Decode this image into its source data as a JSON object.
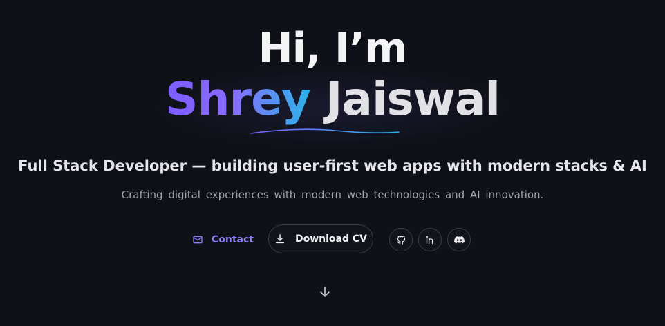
{
  "hero": {
    "greeting": "Hi, I’m",
    "first_name": "Shrey",
    "last_name": "Jaiswal",
    "tagline": "Full Stack Developer — building user-first web apps with modern stacks & AI",
    "subtitle": "Crafting digital experiences with modern web technologies and AI innovation."
  },
  "actions": {
    "contact_label": "Contact",
    "download_label": "Download CV"
  },
  "icons": {
    "contact": "mail-icon",
    "download": "download-icon",
    "github": "github-icon",
    "linkedin": "linkedin-icon",
    "discord": "discord-icon",
    "scroll": "arrow-down-icon"
  },
  "colors": {
    "background": "#0f1118",
    "accent": "#8b7bff",
    "gradient_start": "#7c5cff",
    "gradient_end": "#2bb3e6",
    "border": "#3b3d46"
  }
}
